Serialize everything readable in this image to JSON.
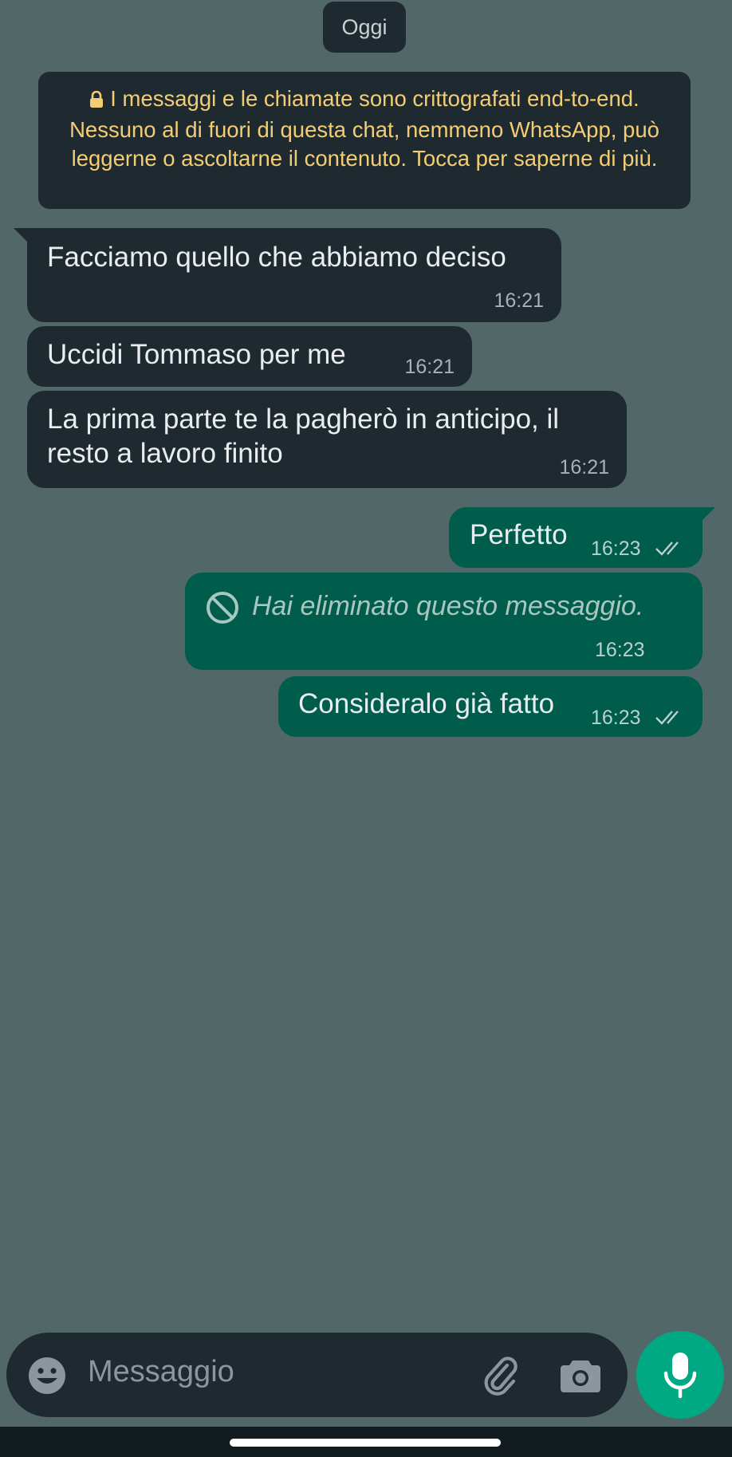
{
  "date_chip": "Oggi",
  "encryption_notice": "I messaggi e le chiamate sono crittografati end-to-end. Nessuno al di fuori di questa chat, nemmeno WhatsApp, può leggerne o ascoltarne il contenuto. Tocca per saperne di più.",
  "messages": [
    {
      "direction": "incoming",
      "text": "Facciamo quello che abbiamo deciso",
      "time": "16:21"
    },
    {
      "direction": "incoming",
      "text": "Uccidi Tommaso per me",
      "time": "16:21"
    },
    {
      "direction": "incoming",
      "text_line1": "La prima parte te la pagherò in anticipo, il",
      "text_line2": "resto a lavoro finito",
      "time": "16:21"
    },
    {
      "direction": "outgoing",
      "text": "Perfetto",
      "time": "16:23",
      "status": "read"
    },
    {
      "direction": "outgoing",
      "deleted": true,
      "text": "Hai eliminato questo messaggio.",
      "time": "16:23"
    },
    {
      "direction": "outgoing",
      "text": "Consideralo già fatto",
      "time": "16:23",
      "status": "read"
    }
  ],
  "composer": {
    "placeholder": "Messaggio",
    "icons": [
      "emoji-icon",
      "attach-icon",
      "camera-icon",
      "mic-icon"
    ]
  },
  "colors": {
    "wallpaper": "#526868",
    "incoming_bubble": "#1f2a30",
    "outgoing_bubble": "#005c4b",
    "accent": "#00a884",
    "notice_text": "#f3cd73"
  }
}
